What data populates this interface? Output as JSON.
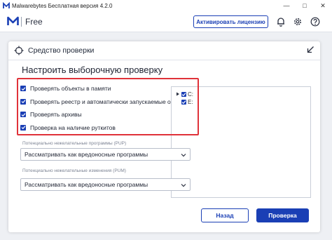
{
  "window": {
    "title": "Malwarebytes Бесплатная версия  4.2.0",
    "controls": [
      "minimize",
      "maximize",
      "close"
    ]
  },
  "header": {
    "edition": "Free",
    "activate_label": "Активировать лицензию",
    "icons": [
      "bell-icon",
      "gear-icon",
      "help-icon"
    ],
    "brand_color": "#1a3fb5"
  },
  "dialog": {
    "title": "Средство проверки",
    "heading": "Настроить выборочную проверку",
    "options": [
      {
        "label": "Проверять объекты в памяти",
        "checked": true
      },
      {
        "label": "Проверять реестр и автоматически запускаемые объекты",
        "checked": true
      },
      {
        "label": "Проверять архивы",
        "checked": true
      },
      {
        "label": "Проверка на наличие руткитов",
        "checked": true
      }
    ],
    "pup": {
      "label": "Потенциально нежелательные программы (PUP)",
      "value": "Рассматривать как вредоносные программы"
    },
    "pum": {
      "label": "Потенциально нежелательные изменения (PUM)",
      "value": "Рассматривать как вредоносные программы"
    },
    "drives": [
      {
        "label": "C:",
        "checked": true,
        "expandable": true
      },
      {
        "label": "E:",
        "checked": true,
        "expandable": false
      }
    ],
    "cancel_label": "Назад",
    "scan_label": "Проверка",
    "highlight_color": "#e0323a"
  }
}
